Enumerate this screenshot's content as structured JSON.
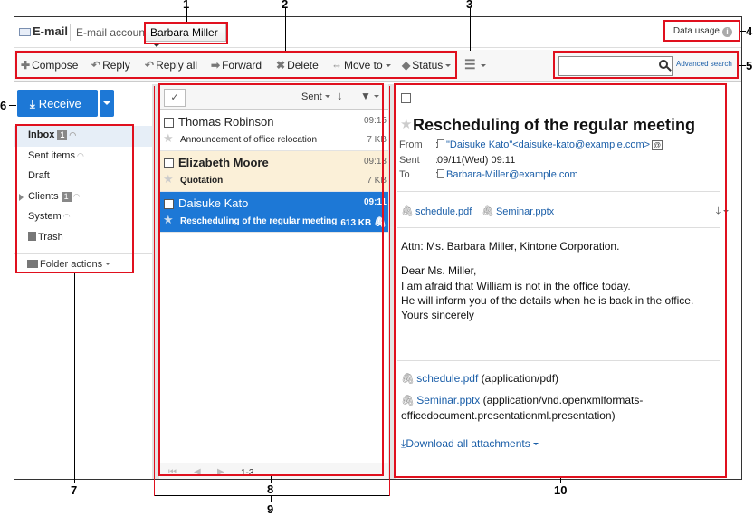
{
  "callouts": [
    "1",
    "2",
    "3",
    "4",
    "5",
    "6",
    "7",
    "8",
    "9",
    "10"
  ],
  "header": {
    "app_title": "E-mail",
    "account_label": "E-mail account:",
    "account_value": "Barbara Miller",
    "data_usage": "Data usage"
  },
  "toolbar": {
    "compose": "Compose",
    "reply": "Reply",
    "reply_all": "Reply all",
    "forward": "Forward",
    "delete": "Delete",
    "move_to": "Move to",
    "status": "Status",
    "search_value": "",
    "advanced_search": "Advanced search"
  },
  "folders": {
    "receive": "Receive",
    "items": [
      {
        "label": "Inbox",
        "badge": "1"
      },
      {
        "label": "Sent items"
      },
      {
        "label": "Draft"
      },
      {
        "label": "Clients",
        "badge": "1"
      },
      {
        "label": "System"
      },
      {
        "label": "Trash"
      }
    ],
    "folder_actions": "Folder actions"
  },
  "mail_list": {
    "sort_label": "Sent",
    "messages": [
      {
        "from": "Thomas Robinson",
        "time": "09:15",
        "subject": "Announcement of office relocation",
        "size": "7 KB"
      },
      {
        "from": "Elizabeth Moore",
        "time": "09:13",
        "subject": "Quotation",
        "size": "7 KB"
      },
      {
        "from": "Daisuke Kato",
        "time": "09:11",
        "subject": "Rescheduling of the regular meeting",
        "size": "613 KB"
      }
    ],
    "page_count": "1-3"
  },
  "preview": {
    "subject": "Rescheduling of the regular meeting",
    "from_label": "From",
    "from_value": "\"Daisuke Kato\"<daisuke-kato@example.com>",
    "sent_label": "Sent",
    "sent_value": "09/11(Wed) 09:11",
    "to_label": "To",
    "to_value": "Barbara-Miller@example.com",
    "attachment_1": "schedule.pdf",
    "attachment_2": "Seminar.pptx",
    "body_lines": [
      "Attn: Ms. Barbara Miller, Kintone Corporation.",
      "Dear Ms. Miller,",
      "I am afraid that William is not in the office today.",
      "He will inform you of the details when he is back in the office.",
      "Yours sincerely"
    ],
    "att_list_1_name": "schedule.pdf",
    "att_list_1_type": "(application/pdf)",
    "att_list_2_name": "Seminar.pptx",
    "att_list_2_type_a": "(application/vnd.openxmlformats-",
    "att_list_2_type_b": "officedocument.presentationml.presentation)",
    "download_all": "Download all attachments"
  }
}
